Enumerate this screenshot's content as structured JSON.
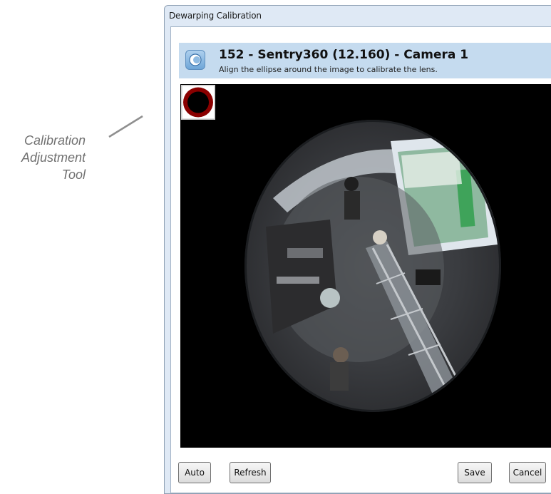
{
  "annotation": {
    "lines": [
      "Calibration",
      "Adjustment",
      "Tool"
    ]
  },
  "window": {
    "title": "Dewarping Calibration"
  },
  "header": {
    "title": "152 - Sentry360 (12.160) - Camera 1",
    "subtitle": "Align the ellipse around the image to calibrate the lens.",
    "icon": "camera-lens-icon"
  },
  "viewport": {
    "tool_icon": "calibration-adjustment-icon",
    "image": "fisheye-camera-view"
  },
  "buttons": {
    "auto": "Auto",
    "refresh": "Refresh",
    "save": "Save",
    "cancel": "Cancel"
  },
  "colors": {
    "header_bg": "#c5dbef",
    "tool_ring": "#8a0000",
    "viewport_bg": "#000000"
  }
}
